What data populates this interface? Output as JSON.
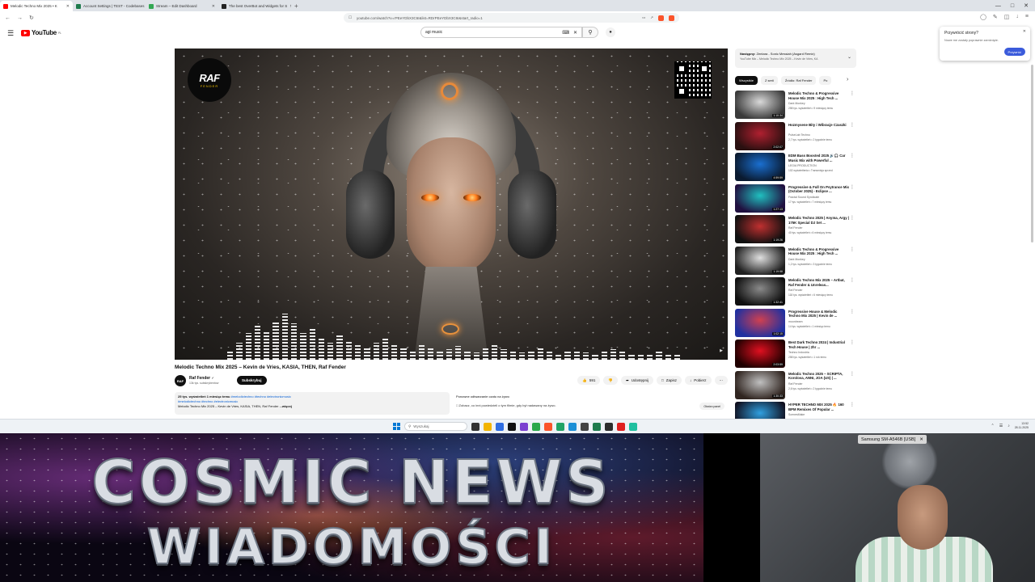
{
  "browser": {
    "tabs": [
      {
        "label": "Melodic Techno Mix 2025 • K",
        "active": true,
        "color": "#ff0000"
      },
      {
        "label": "Account Settings | TEST - Codebases",
        "active": false,
        "color": "#1e7b4d"
      },
      {
        "label": "Stream – Edit Dashboard",
        "active": false,
        "color": "#34a853"
      },
      {
        "label": "The best OverBot and Widgets for S",
        "active": false,
        "color": "#222222"
      }
    ],
    "new_tab": "+",
    "url": "youtube.com/watch?v=rPEeYDbX3C6I&list=RDrPEeYDbX3C6I&start_radio=1"
  },
  "youtube": {
    "logo_text": "YouTube",
    "logo_country": "PL",
    "search_value": "agi music",
    "video": {
      "title": "Melodic Techno Mix 2025 – Kevin de Vries, KASIA, THEN, Raf Fender",
      "overlay_logo_big": "RAF",
      "overlay_logo_small": "FENDER",
      "channel": "Raf Fender",
      "channel_avatar_text": "RAF",
      "subscribers": "13k tys. subskrybentów",
      "subscribe_label": "Subskrybuj",
      "likes": "591",
      "share_label": "Udostępnij",
      "save_label": "Zapisz",
      "download_label": "Pobierz",
      "description_stats": "25 tys. wyświetleń  1 miesiąc temu",
      "description_tags_inline": "#melodictechno #techno #electronicmusic",
      "description_tags": "#melodictechno #techno #electronicmusic",
      "description_text": "Melodic Techno Mix 2025 – Kevin de Vries, KASIA, THEN, Raf Fender",
      "description_more": "...więcej",
      "live_title": "Ponowne odtwarzanie czatu na żywo",
      "live_sub": "Zobacz, co inni powiedzieli o tym filmie, gdy był nadawany na żywo.",
      "live_button": "Otwórz panel"
    },
    "next": {
      "label": "Następny:",
      "title": "Zentara - Sonic Messiah (Asgard Remix)",
      "sub": "YouTube Mix – Melodic Techno Mix 2025 – Kevin de Vries, KA"
    },
    "chips": [
      "Wszystkie",
      "Z serii",
      "Źródło: Raf Fender",
      "Po"
    ],
    "related": [
      {
        "title": "Melodic Techno & Progressive House Mix 2025 : High Tech ...",
        "channel": "Dark Monkey",
        "meta": "258 tys. wyświetleń • 9 miesięcy temu",
        "duration": "1:10:34",
        "c1": "#d9d9d9",
        "c2": "#3a3a3a"
      },
      {
        "title": "Hozmysene Bity i Wibracje Czaszki",
        "channel": "PulseLab Techno",
        "meta": "2,7 tys. wyświetleń • 2 tygodnie temu",
        "duration": "2:02:07",
        "c1": "#b02030",
        "c2": "#2a1010"
      },
      {
        "title": "EDM Bass Boosted 2025 🔊🎧 Car Music Mix with Powerful ...",
        "channel": "LEGIA PRODUCTION",
        "meta": "102 wyświetlenia • Transmisja sprzed",
        "duration": "4:59:59",
        "c1": "#1a6fd0",
        "c2": "#0a1a30"
      },
      {
        "title": "Progressive & Full On Psytrance Mix (October 2025) - Eclipse ...",
        "channel": "Fractal Sound Syndicate",
        "meta": "17 tys. wyświetleń • 7 miesięcy temu",
        "duration": "1:27:13",
        "c1": "#20c0c0",
        "c2": "#201040"
      },
      {
        "title": "Melodic Techno 2025 | Anyma, Argy  | 175K Special DJ Set ...",
        "channel": "Raf Fender",
        "meta": "40 tys. wyświetleń • 6 miesięcy temu",
        "duration": "1:19:26",
        "c1": "#c03030",
        "c2": "#101010"
      },
      {
        "title": "Melodic Techno & Progressive House Mix 2025 : High Tech ...",
        "channel": "Dark Monkey",
        "meta": "1,2 tys. wyświetleń • 3 tygodnie temu",
        "duration": "1:19:58",
        "c1": "#e0e0e0",
        "c2": "#202020"
      },
      {
        "title": "Melodic Techno Mix 2025 – Artbat, Raf Fender & Unreleas...",
        "channel": "Raf Fender",
        "meta": "118 tys. wyświetleń • 6 miesięcy temu",
        "duration": "1:32:41",
        "c1": "#8a8a8a",
        "c2": "#101010"
      },
      {
        "title": "Progressive House & Melodic Techno Mix 2025 | Kevin de ...",
        "channel": "moonbeam",
        "meta": "14 tys. wyświetleń • 1 miesiąc temu",
        "duration": "1:02:15",
        "c1": "#d04050",
        "c2": "#2030a0"
      },
      {
        "title": "Best Dark Techno 2024 | Industrial Tech House | 2hr ...",
        "channel": "Techno Industria",
        "meta": "258 tys. wyświetleń • 1 rok temu",
        "duration": "2:03:59",
        "c1": "#e01020",
        "c2": "#200000"
      },
      {
        "title": "Melodic Techno 2025 – SCRIPTA, Korolova, ANNI, JOA (US) | ...",
        "channel": "Raf Fender",
        "meta": "2,6 tys. wyświetleń • 2 tygodnie temu",
        "duration": "1:30:33",
        "c1": "#c0c0c0",
        "c2": "#302520"
      },
      {
        "title": "HYPER TECHNO MIX 2025 🔥 160 BPM Remixes Of Popular ...",
        "channel": "ScenesMake",
        "meta": "",
        "duration": "",
        "c1": "#30a0e0",
        "c2": "#101020"
      }
    ],
    "popup": {
      "title": "Przywrócić strony?",
      "subtitle": "Nowe me zostały poprawnie zamknięte.",
      "button": "Przywróć"
    }
  },
  "taskbar": {
    "search_placeholder": "Wyszukaj",
    "time": "13:52",
    "date": "28.11.2025"
  },
  "stream": {
    "line1": "COSMIC NEWS",
    "line2": "WIADOMOŚCI",
    "cam_label": "Samsung SM-A546B [USB]"
  }
}
